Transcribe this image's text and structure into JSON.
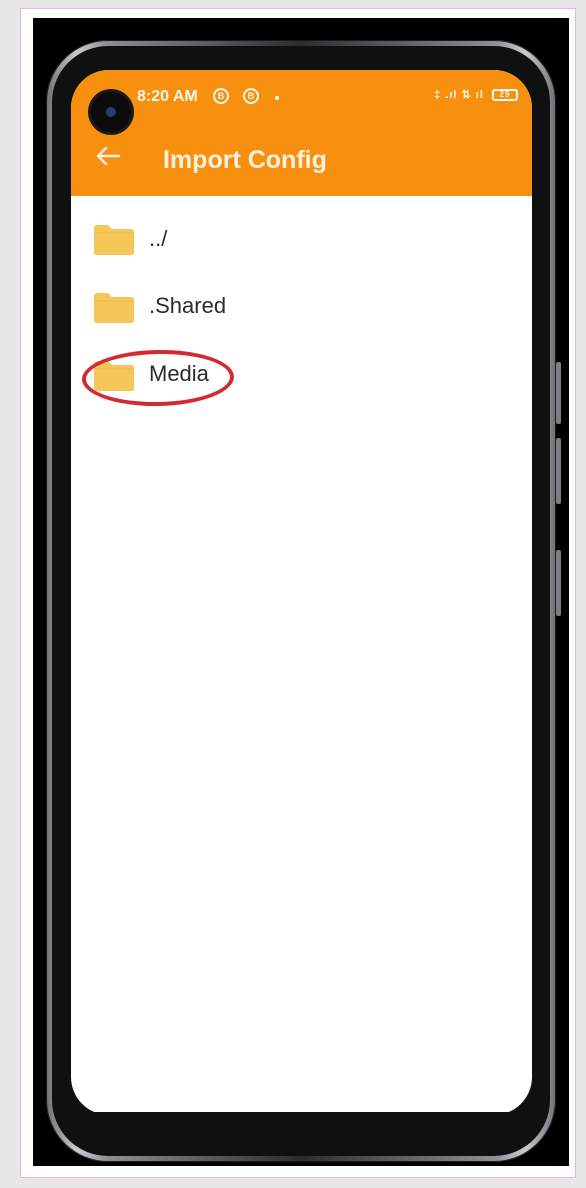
{
  "status_bar": {
    "time": "8:20 AM",
    "icon_b1": "B",
    "icon_b2": "B",
    "right_text": "‡ .ıl ⇅ ıl",
    "battery": "29"
  },
  "appbar": {
    "title": "Import Config",
    "back_icon": "arrow-left-icon"
  },
  "folders": [
    {
      "label": "../",
      "icon": "folder-icon"
    },
    {
      "label": ".Shared",
      "icon": "folder-icon"
    },
    {
      "label": "Media",
      "icon": "folder-icon",
      "highlighted": true
    }
  ],
  "colors": {
    "appbar": "#f7900e",
    "folder": "#f6c659",
    "highlight": "#d32a32"
  }
}
